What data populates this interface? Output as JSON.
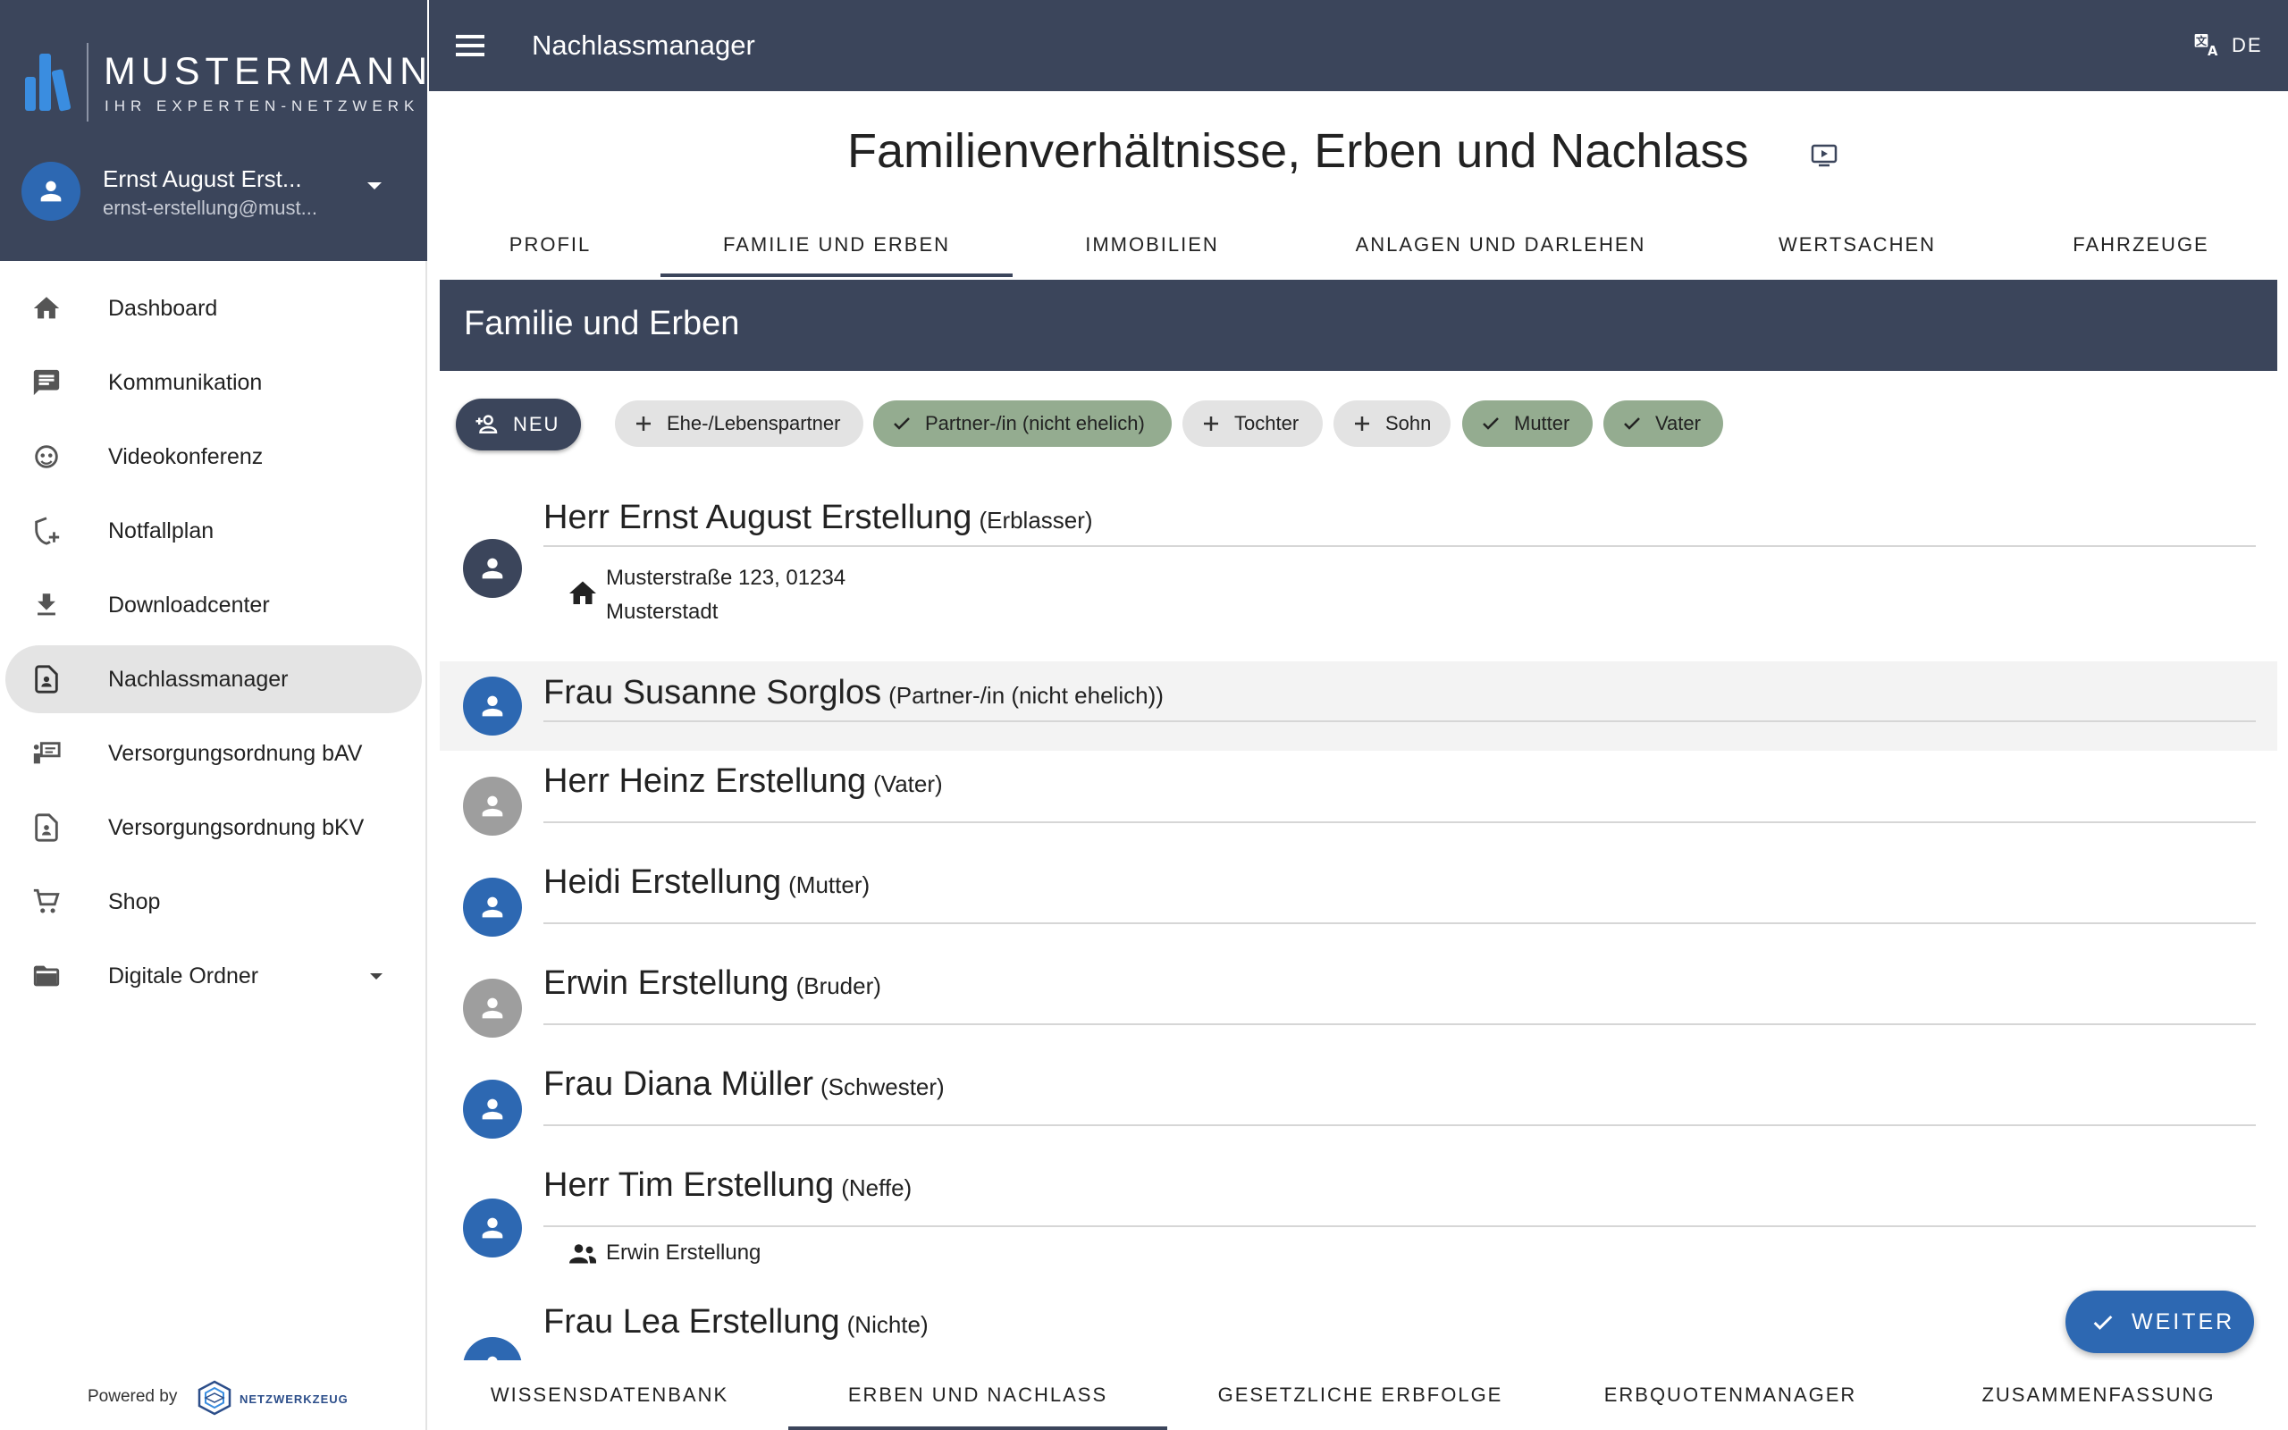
{
  "brand": {
    "title": "MUSTERMANN",
    "subtitle": "IHR EXPERTEN-NETZWERK"
  },
  "user": {
    "name": "Ernst August Erst...",
    "email": "ernst-erstellung@must..."
  },
  "nav": [
    {
      "label": "Dashboard",
      "icon": "home-icon"
    },
    {
      "label": "Kommunikation",
      "icon": "chat-icon"
    },
    {
      "label": "Videokonferenz",
      "icon": "video-conference-icon"
    },
    {
      "label": "Notfallplan",
      "icon": "shield-plus-icon"
    },
    {
      "label": "Downloadcenter",
      "icon": "download-icon"
    },
    {
      "label": "Nachlassmanager",
      "icon": "document-person-icon",
      "active": true
    },
    {
      "label": "Versorgungsordnung bAV",
      "icon": "presentation-icon"
    },
    {
      "label": "Versorgungsordnung bKV",
      "icon": "document-medical-icon"
    },
    {
      "label": "Shop",
      "icon": "cart-icon"
    },
    {
      "label": "Digitale Ordner",
      "icon": "folder-open-icon",
      "expandable": true
    }
  ],
  "footer": {
    "powered_by": "Powered by",
    "partner": "NETZWERKZEUG"
  },
  "topbar": {
    "title": "Nachlassmanager",
    "language": "DE"
  },
  "page": {
    "title": "Familienverhältnisse, Erben und Nachlass"
  },
  "tabs_top": [
    {
      "label": "PROFIL"
    },
    {
      "label": "FAMILIE UND ERBEN",
      "active": true
    },
    {
      "label": "IMMOBILIEN"
    },
    {
      "label": "ANLAGEN UND DARLEHEN"
    },
    {
      "label": "WERTSACHEN"
    },
    {
      "label": "FAHRZEUGE"
    }
  ],
  "section": {
    "title": "Familie und Erben"
  },
  "new_button": "NEU",
  "chips": [
    {
      "label": "Ehe-/Lebenspartner",
      "selected": false
    },
    {
      "label": "Partner-/in (nicht ehelich)",
      "selected": true
    },
    {
      "label": "Tochter",
      "selected": false
    },
    {
      "label": "Sohn",
      "selected": false
    },
    {
      "label": "Mutter",
      "selected": true
    },
    {
      "label": "Vater",
      "selected": true
    }
  ],
  "people": [
    {
      "name": "Herr Ernst August Erstellung",
      "role": "(Erblasser)",
      "avatar": "dark",
      "address": [
        "Musterstraße 123, 01234",
        "Musterstadt"
      ]
    },
    {
      "name": "Frau Susanne Sorglos",
      "role": "(Partner-/in (nicht ehelich))",
      "avatar": "blue",
      "highlight": true
    },
    {
      "name": "Herr Heinz Erstellung",
      "role": "(Vater)",
      "avatar": "grey"
    },
    {
      "name": "Heidi Erstellung",
      "role": "(Mutter)",
      "avatar": "blue"
    },
    {
      "name": "Erwin Erstellung",
      "role": "(Bruder)",
      "avatar": "grey"
    },
    {
      "name": "Frau Diana Müller",
      "role": "(Schwester)",
      "avatar": "blue"
    },
    {
      "name": "Herr Tim Erstellung",
      "role": "(Neffe)",
      "avatar": "blue",
      "parent": "Erwin Erstellung"
    },
    {
      "name": "Frau Lea Erstellung",
      "role": "(Nichte)",
      "avatar": "blue"
    }
  ],
  "weiter_button": "WEITER",
  "tabs_bottom": [
    {
      "label": "WISSENSDATENBANK"
    },
    {
      "label": "ERBEN UND NACHLASS",
      "active": true
    },
    {
      "label": "GESETZLICHE ERBFOLGE"
    },
    {
      "label": "ERBQUOTENMANAGER"
    },
    {
      "label": "ZUSAMMENFASSUNG"
    }
  ],
  "colors": {
    "primary_dark": "#3b455b",
    "accent_blue": "#2d68b2",
    "chip_selected": "#94ac90",
    "chip_default": "#e3e3e3"
  }
}
